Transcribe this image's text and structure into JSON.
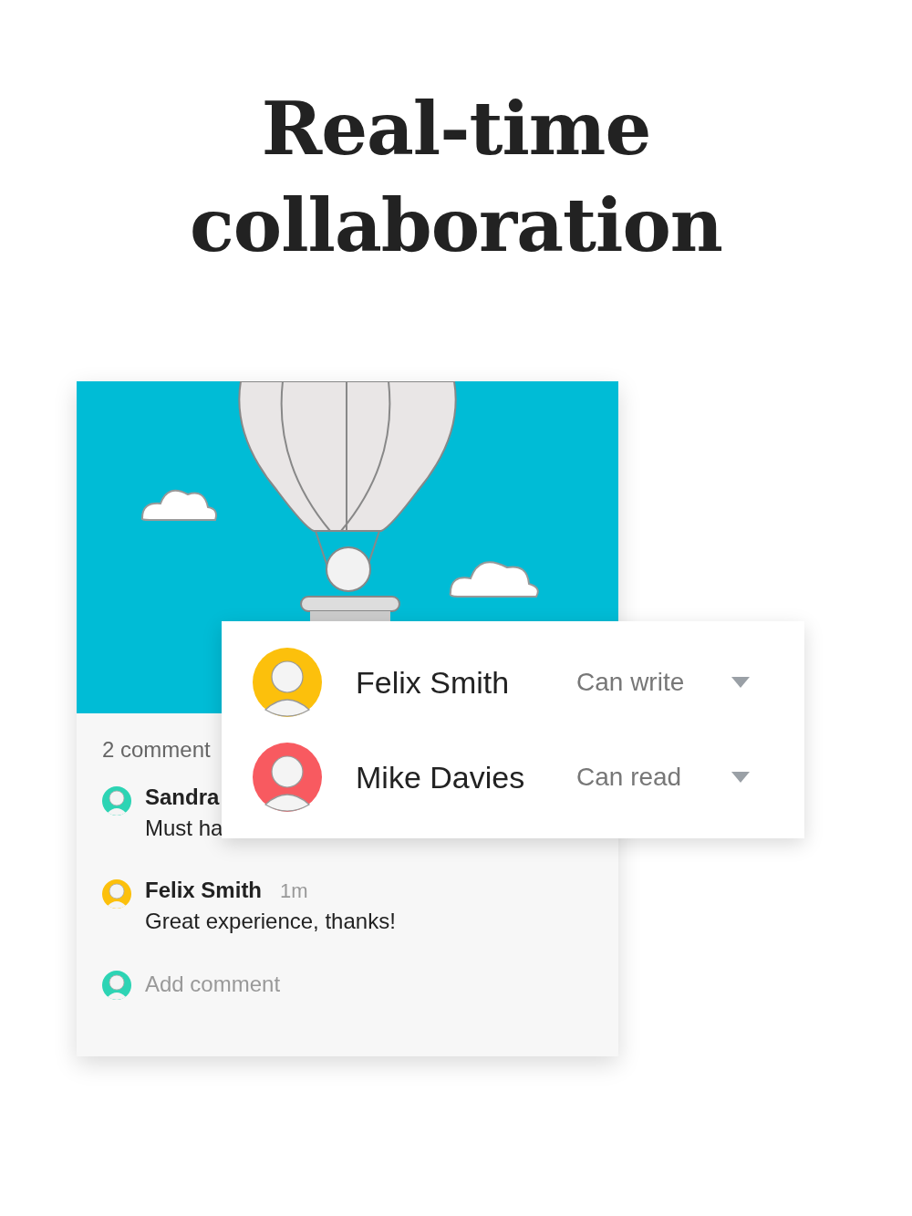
{
  "headline": "Real-time collaboration",
  "post": {
    "comments_count": "2 comment",
    "comments": [
      {
        "author": "Sandra",
        "text": "Must ha",
        "color": "#2dd4b4"
      },
      {
        "author": "Felix Smith",
        "time": "1m",
        "text": "Great experience, thanks!",
        "color": "#fcc00c"
      }
    ],
    "add_comment": {
      "placeholder": "Add comment"
    }
  },
  "share": {
    "people": [
      {
        "name": "Felix Smith",
        "permission": "Can write",
        "color": "#fcc00c"
      },
      {
        "name": "Mike Davies",
        "permission": "Can read",
        "color": "#f85a60"
      }
    ]
  }
}
